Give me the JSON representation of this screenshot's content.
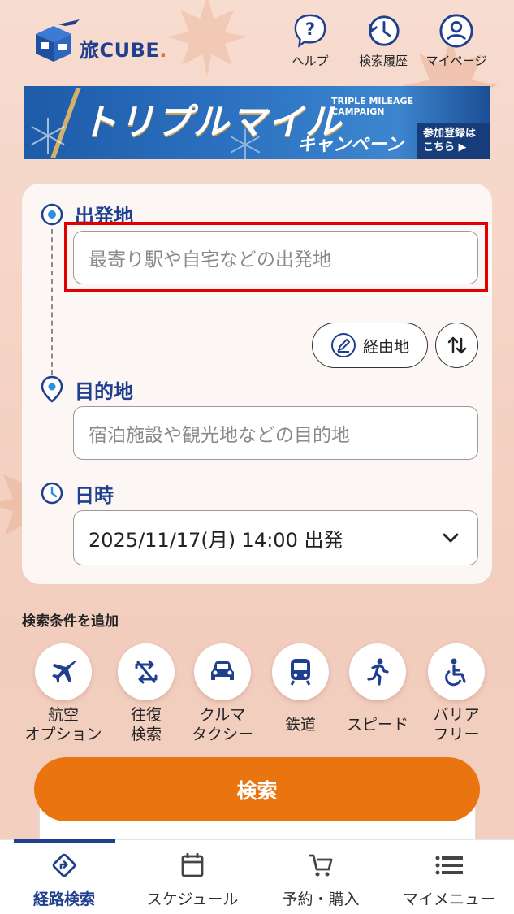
{
  "header": {
    "logo_text": "旅CUBE",
    "help_label": "ヘルプ",
    "history_label": "検索履歴",
    "mypage_label": "マイページ"
  },
  "banner": {
    "main": "トリプルマイル",
    "english_line1": "TRIPLE MILEAGE",
    "english_line2": "CAMPAIGN",
    "campaign": "キャンペーン",
    "cta_line1": "参加登録は",
    "cta_line2": "こちら ▶"
  },
  "form": {
    "origin_label": "出発地",
    "origin_placeholder": "最寄り駅や自宅などの出発地",
    "via_label": "経由地",
    "destination_label": "目的地",
    "destination_placeholder": "宿泊施設や観光地などの目的地",
    "datetime_label": "日時",
    "datetime_value": "2025/11/17(月) 14:00 出発"
  },
  "conditions": {
    "title": "検索条件を追加",
    "options": [
      {
        "line1": "航空",
        "line2": "オプション",
        "icon": "airplane-icon"
      },
      {
        "line1": "往復",
        "line2": "検索",
        "icon": "round-trip-icon"
      },
      {
        "line1": "クルマ",
        "line2": "タクシー",
        "icon": "car-icon"
      },
      {
        "line1": "鉄道",
        "line2": "",
        "icon": "train-icon"
      },
      {
        "line1": "スピード",
        "line2": "",
        "icon": "running-icon"
      },
      {
        "line1": "バリア",
        "line2": "フリー",
        "icon": "wheelchair-icon"
      }
    ]
  },
  "search_button": "検索",
  "bottom_nav": {
    "items": [
      {
        "label": "経路検索",
        "active": true
      },
      {
        "label": "スケジュール"
      },
      {
        "label": "予約・購入"
      },
      {
        "label": "マイメニュー"
      }
    ]
  },
  "colors": {
    "brand_navy": "#1f3f8f",
    "accent_orange": "#ea7410",
    "highlight_red": "#e00000"
  }
}
